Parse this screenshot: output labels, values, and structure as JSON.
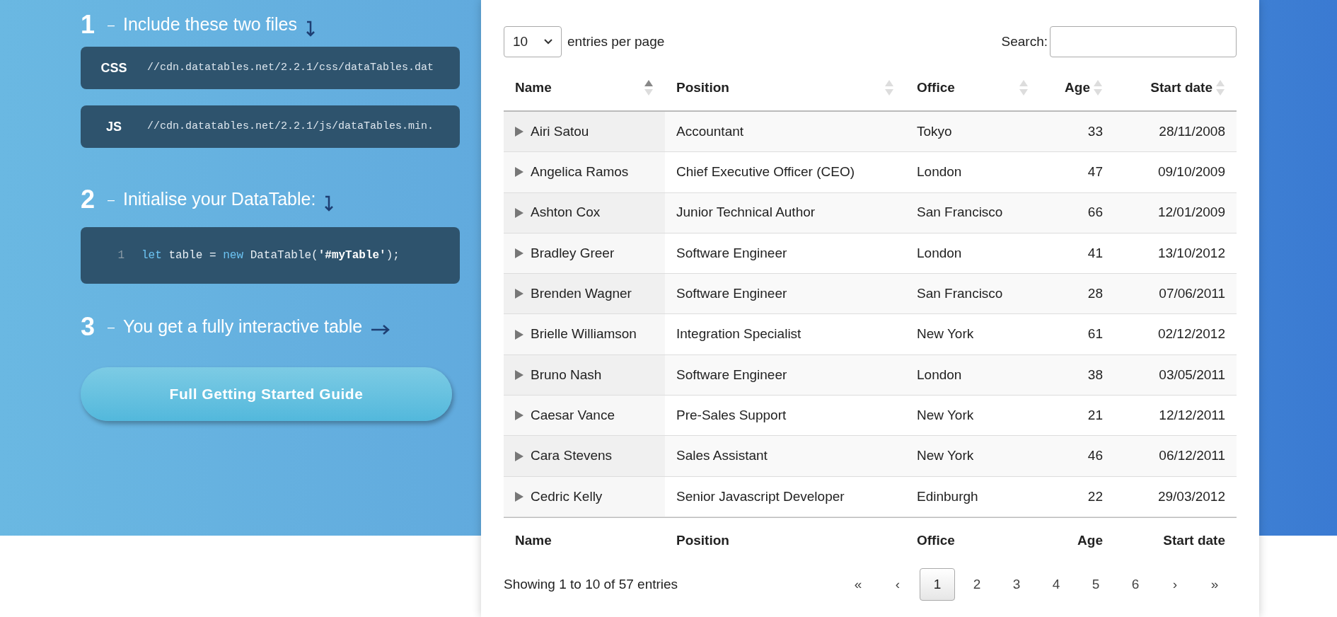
{
  "steps": [
    {
      "number": "1",
      "dash": "–",
      "text": "Include these two files",
      "kind": "down"
    },
    {
      "number": "2",
      "dash": "–",
      "text": "Initialise your DataTable:",
      "kind": "down"
    },
    {
      "number": "3",
      "dash": "–",
      "text": "You get a fully interactive table",
      "kind": "right"
    }
  ],
  "files": [
    {
      "label": "CSS",
      "url": "//cdn.datatables.net/2.2.1/css/dataTables.dat"
    },
    {
      "label": "JS",
      "url": "//cdn.datatables.net/2.2.1/js/dataTables.min."
    }
  ],
  "code": {
    "line_number": "1",
    "tokens": [
      {
        "kind": "keyword",
        "text": "let"
      },
      {
        "kind": "plain",
        "text": " table = "
      },
      {
        "kind": "keyword",
        "text": "new"
      },
      {
        "kind": "plain",
        "text": " DataTable("
      },
      {
        "kind": "string",
        "text": "'#myTable'"
      },
      {
        "kind": "plain",
        "text": ");"
      }
    ]
  },
  "guide_button": "Full Getting Started Guide",
  "table": {
    "page_length": "10",
    "page_length_label": "entries per page",
    "search_label": "Search:",
    "columns": [
      {
        "label": "Name",
        "sorted": true,
        "kind": "text"
      },
      {
        "label": "Position",
        "sorted": false,
        "kind": "text"
      },
      {
        "label": "Office",
        "sorted": false,
        "kind": "text"
      },
      {
        "label": "Age",
        "sorted": false,
        "kind": "number"
      },
      {
        "label": "Start date",
        "sorted": false,
        "kind": "number"
      }
    ],
    "rows": [
      [
        "Airi Satou",
        "Accountant",
        "Tokyo",
        "33",
        "28/11/2008"
      ],
      [
        "Angelica Ramos",
        "Chief Executive Officer (CEO)",
        "London",
        "47",
        "09/10/2009"
      ],
      [
        "Ashton Cox",
        "Junior Technical Author",
        "San Francisco",
        "66",
        "12/01/2009"
      ],
      [
        "Bradley Greer",
        "Software Engineer",
        "London",
        "41",
        "13/10/2012"
      ],
      [
        "Brenden Wagner",
        "Software Engineer",
        "San Francisco",
        "28",
        "07/06/2011"
      ],
      [
        "Brielle Williamson",
        "Integration Specialist",
        "New York",
        "61",
        "02/12/2012"
      ],
      [
        "Bruno Nash",
        "Software Engineer",
        "London",
        "38",
        "03/05/2011"
      ],
      [
        "Caesar Vance",
        "Pre-Sales Support",
        "New York",
        "21",
        "12/12/2011"
      ],
      [
        "Cara Stevens",
        "Sales Assistant",
        "New York",
        "46",
        "06/12/2011"
      ],
      [
        "Cedric Kelly",
        "Senior Javascript Developer",
        "Edinburgh",
        "22",
        "29/03/2012"
      ]
    ],
    "footer": [
      "Name",
      "Position",
      "Office",
      "Age",
      "Start date"
    ],
    "info": "Showing 1 to 10 of 57 entries",
    "pager": [
      {
        "label": "«",
        "selected": false
      },
      {
        "label": "‹",
        "selected": false
      },
      {
        "label": "1",
        "selected": true
      },
      {
        "label": "2",
        "selected": false
      },
      {
        "label": "3",
        "selected": false
      },
      {
        "label": "4",
        "selected": false
      },
      {
        "label": "5",
        "selected": false
      },
      {
        "label": "6",
        "selected": false
      },
      {
        "label": "›",
        "selected": false
      },
      {
        "label": "»",
        "selected": false
      }
    ]
  }
}
